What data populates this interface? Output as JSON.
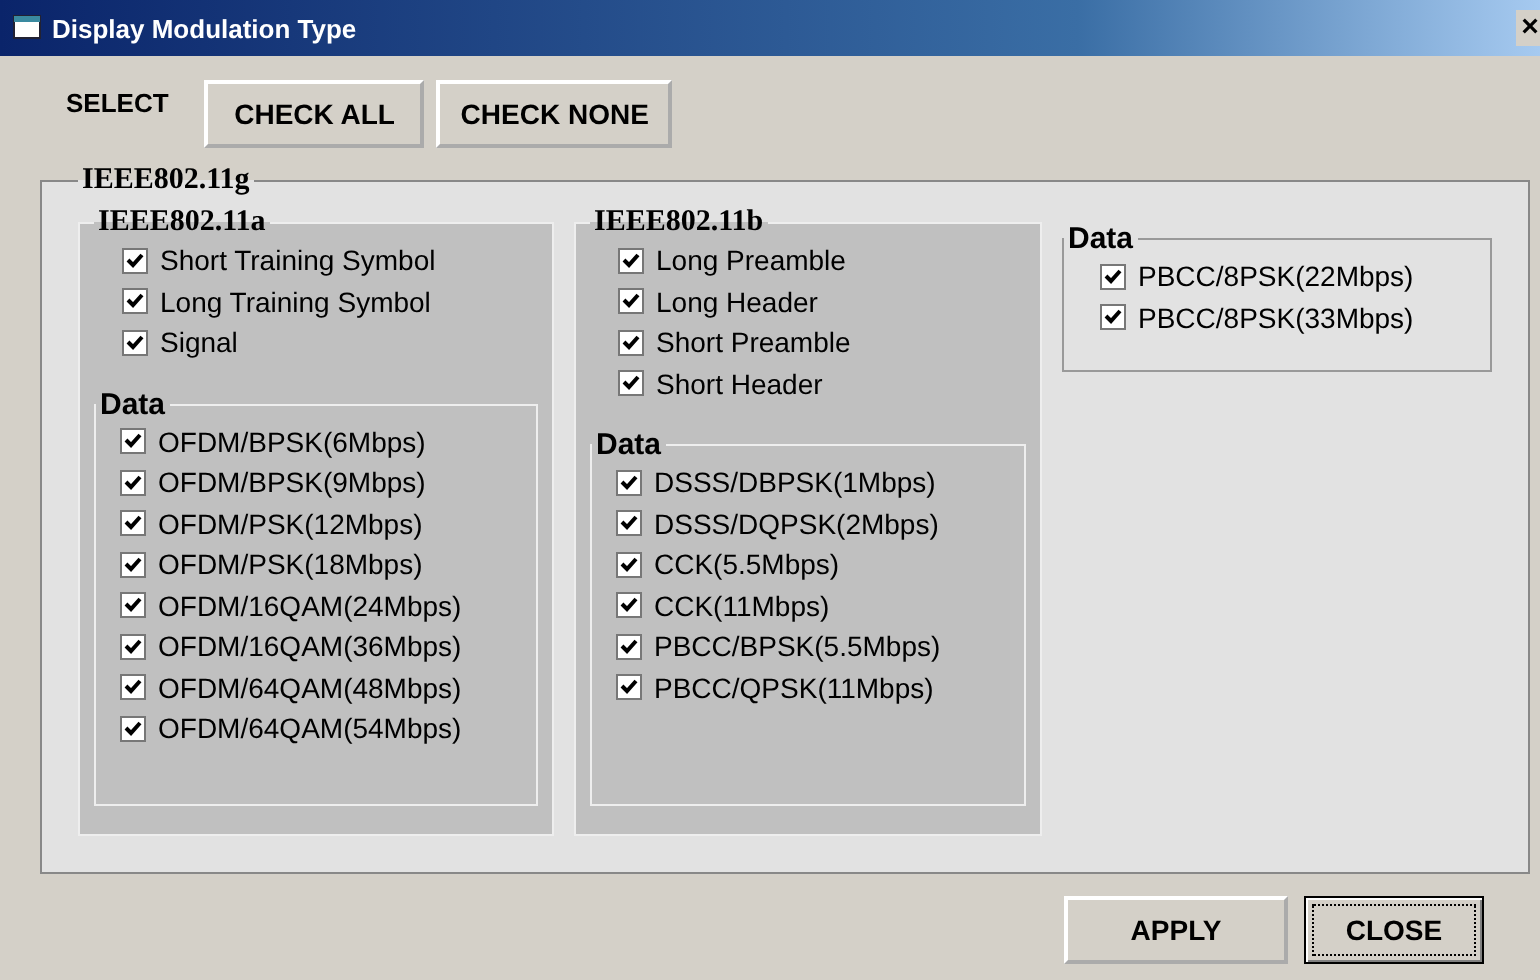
{
  "window": {
    "title": "Display Modulation Type",
    "close_glyph": "×"
  },
  "select": {
    "label": "SELECT",
    "buttons": [
      {
        "label": "CHECK ALL"
      },
      {
        "label": "CHECK NONE"
      }
    ]
  },
  "group": {
    "title": "IEEE802.11g",
    "panels": [
      {
        "title": "IEEE802.11a",
        "options": [
          {
            "label": "Short Training Symbol",
            "checked": true
          },
          {
            "label": "Long Training Symbol",
            "checked": true
          },
          {
            "label": "Signal",
            "checked": true
          }
        ],
        "data": {
          "title": "Data",
          "options": [
            {
              "label": "OFDM/BPSK(6Mbps)",
              "checked": true
            },
            {
              "label": "OFDM/BPSK(9Mbps)",
              "checked": true
            },
            {
              "label": "OFDM/PSK(12Mbps)",
              "checked": true
            },
            {
              "label": "OFDM/PSK(18Mbps)",
              "checked": true
            },
            {
              "label": "OFDM/16QAM(24Mbps)",
              "checked": true
            },
            {
              "label": "OFDM/16QAM(36Mbps)",
              "checked": true
            },
            {
              "label": "OFDM/64QAM(48Mbps)",
              "checked": true
            },
            {
              "label": "OFDM/64QAM(54Mbps)",
              "checked": true
            }
          ]
        }
      },
      {
        "title": "IEEE802.11b",
        "options": [
          {
            "label": "Long Preamble",
            "checked": true
          },
          {
            "label": "Long Header",
            "checked": true
          },
          {
            "label": "Short Preamble",
            "checked": true
          },
          {
            "label": "Short Header",
            "checked": true
          }
        ],
        "data": {
          "title": "Data",
          "options": [
            {
              "label": "DSSS/DBPSK(1Mbps)",
              "checked": true
            },
            {
              "label": "DSSS/DQPSK(2Mbps)",
              "checked": true
            },
            {
              "label": "CCK(5.5Mbps)",
              "checked": true
            },
            {
              "label": "CCK(11Mbps)",
              "checked": true
            },
            {
              "label": "PBCC/BPSK(5.5Mbps)",
              "checked": true
            },
            {
              "label": "PBCC/QPSK(11Mbps)",
              "checked": true
            }
          ]
        }
      }
    ],
    "data": {
      "title": "Data",
      "options": [
        {
          "label": "PBCC/8PSK(22Mbps)",
          "checked": true
        },
        {
          "label": "PBCC/8PSK(33Mbps)",
          "checked": true
        }
      ]
    }
  },
  "footer": {
    "buttons": [
      {
        "label": "APPLY",
        "focused": false
      },
      {
        "label": "CLOSE",
        "focused": true
      }
    ]
  }
}
